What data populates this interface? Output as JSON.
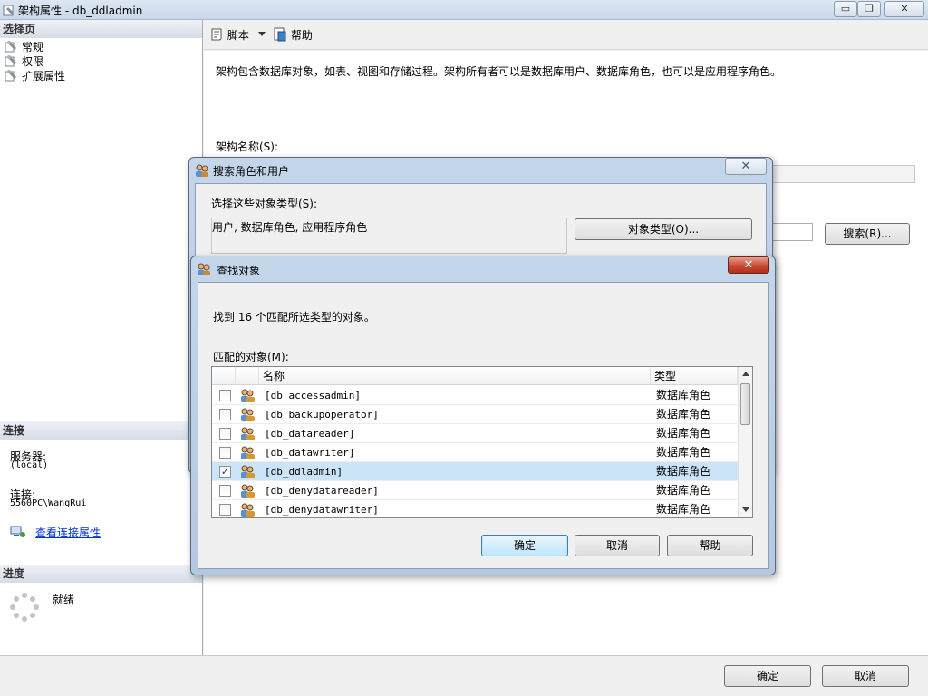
{
  "window": {
    "title": "架构属性 - db_ddladmin",
    "minimize": "▭",
    "restore": "❐",
    "close": "✕"
  },
  "left_pane": {
    "select_page_header": "选择页",
    "nav_items": [
      {
        "label": "常规",
        "icon": "wrench-page-icon"
      },
      {
        "label": "权限",
        "icon": "wrench-page-icon"
      },
      {
        "label": "扩展属性",
        "icon": "wrench-page-icon"
      }
    ],
    "connection_header": "连接",
    "server_label": "服务器:",
    "server_value": "(local)",
    "connection_label": "连接:",
    "connection_value": "5560PC\\WangRui",
    "view_connection_properties": "查看连接属性",
    "progress_header": "进度",
    "progress_status": "就绪"
  },
  "toolbar": {
    "script_label": "脚本",
    "help_label": "帮助"
  },
  "content": {
    "description": "架构包含数据库对象，如表、视图和存储过程。架构所有者可以是数据库用户、数据库角色，也可以是应用程序角色。",
    "schema_name_label": "架构名称(S):",
    "search_button": "搜索(R)..."
  },
  "bottom_bar": {
    "ok_label": "确定",
    "cancel_label": "取消"
  },
  "search_dialog": {
    "title": "搜索角色和用户",
    "select_types_label": "选择这些对象类型(S):",
    "object_types_value": "用户, 数据库角色, 应用程序角色",
    "object_types_button": "对象类型(O)...",
    "close": "✕"
  },
  "find_dialog": {
    "title": "查找对象",
    "found_text": "找到 16 个匹配所选类型的对象。",
    "matched_label": "匹配的对象(M):",
    "columns": {
      "name": "名称",
      "type": "类型"
    },
    "rows": [
      {
        "name": "[db_accessadmin]",
        "type": "数据库角色",
        "checked": false
      },
      {
        "name": "[db_backupoperator]",
        "type": "数据库角色",
        "checked": false
      },
      {
        "name": "[db_datareader]",
        "type": "数据库角色",
        "checked": false
      },
      {
        "name": "[db_datawriter]",
        "type": "数据库角色",
        "checked": false
      },
      {
        "name": "[db_ddladmin]",
        "type": "数据库角色",
        "checked": true
      },
      {
        "name": "[db_denydatareader]",
        "type": "数据库角色",
        "checked": false
      },
      {
        "name": "[db_denydatawriter]",
        "type": "数据库角色",
        "checked": false
      }
    ],
    "ok_label": "确定",
    "cancel_label": "取消",
    "help_label": "帮助",
    "close": "✕",
    "check_mark": "✓"
  }
}
